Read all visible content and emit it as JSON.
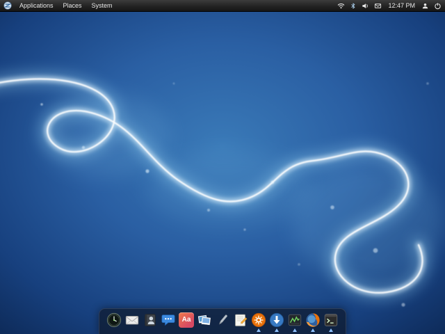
{
  "panel": {
    "logo": "distro-logo",
    "menus": [
      {
        "label": "Applications"
      },
      {
        "label": "Places"
      },
      {
        "label": "System"
      }
    ],
    "tray": [
      {
        "icon": "wifi-icon"
      },
      {
        "icon": "bluetooth-icon"
      },
      {
        "icon": "volume-icon"
      },
      {
        "icon": "mail-icon"
      }
    ],
    "clock": "12:47 PM",
    "tray_right": [
      {
        "icon": "session-icon"
      },
      {
        "icon": "power-icon"
      }
    ]
  },
  "dock": {
    "items": [
      {
        "icon": "clock",
        "name": "clock-icon",
        "running": false
      },
      {
        "icon": "mail",
        "name": "mail-app-icon",
        "running": false
      },
      {
        "icon": "contacts",
        "name": "contacts-icon",
        "running": false
      },
      {
        "icon": "chat",
        "name": "chat-icon",
        "running": false
      },
      {
        "icon": "fonts",
        "name": "fonts-icon",
        "label": "Aa",
        "running": false
      },
      {
        "icon": "photos",
        "name": "photos-icon",
        "running": false
      },
      {
        "icon": "pen",
        "name": "pen-icon",
        "running": false
      },
      {
        "icon": "notes",
        "name": "notes-icon",
        "running": false
      },
      {
        "icon": "software",
        "name": "software-center-icon",
        "running": true
      },
      {
        "icon": "downloads",
        "name": "downloads-icon",
        "running": true
      },
      {
        "icon": "monitor",
        "name": "system-monitor-icon",
        "running": true
      },
      {
        "icon": "firefox",
        "name": "firefox-icon",
        "running": true
      },
      {
        "icon": "terminal",
        "name": "terminal-icon",
        "running": true
      }
    ]
  },
  "colors": {
    "panel_bg": "#232323",
    "running_indicator": "#8fc1ff",
    "wallpaper_deep": "#0e2c5e",
    "wallpaper_mid": "#2a5fa3",
    "streak_glow": "#bfeaff"
  }
}
